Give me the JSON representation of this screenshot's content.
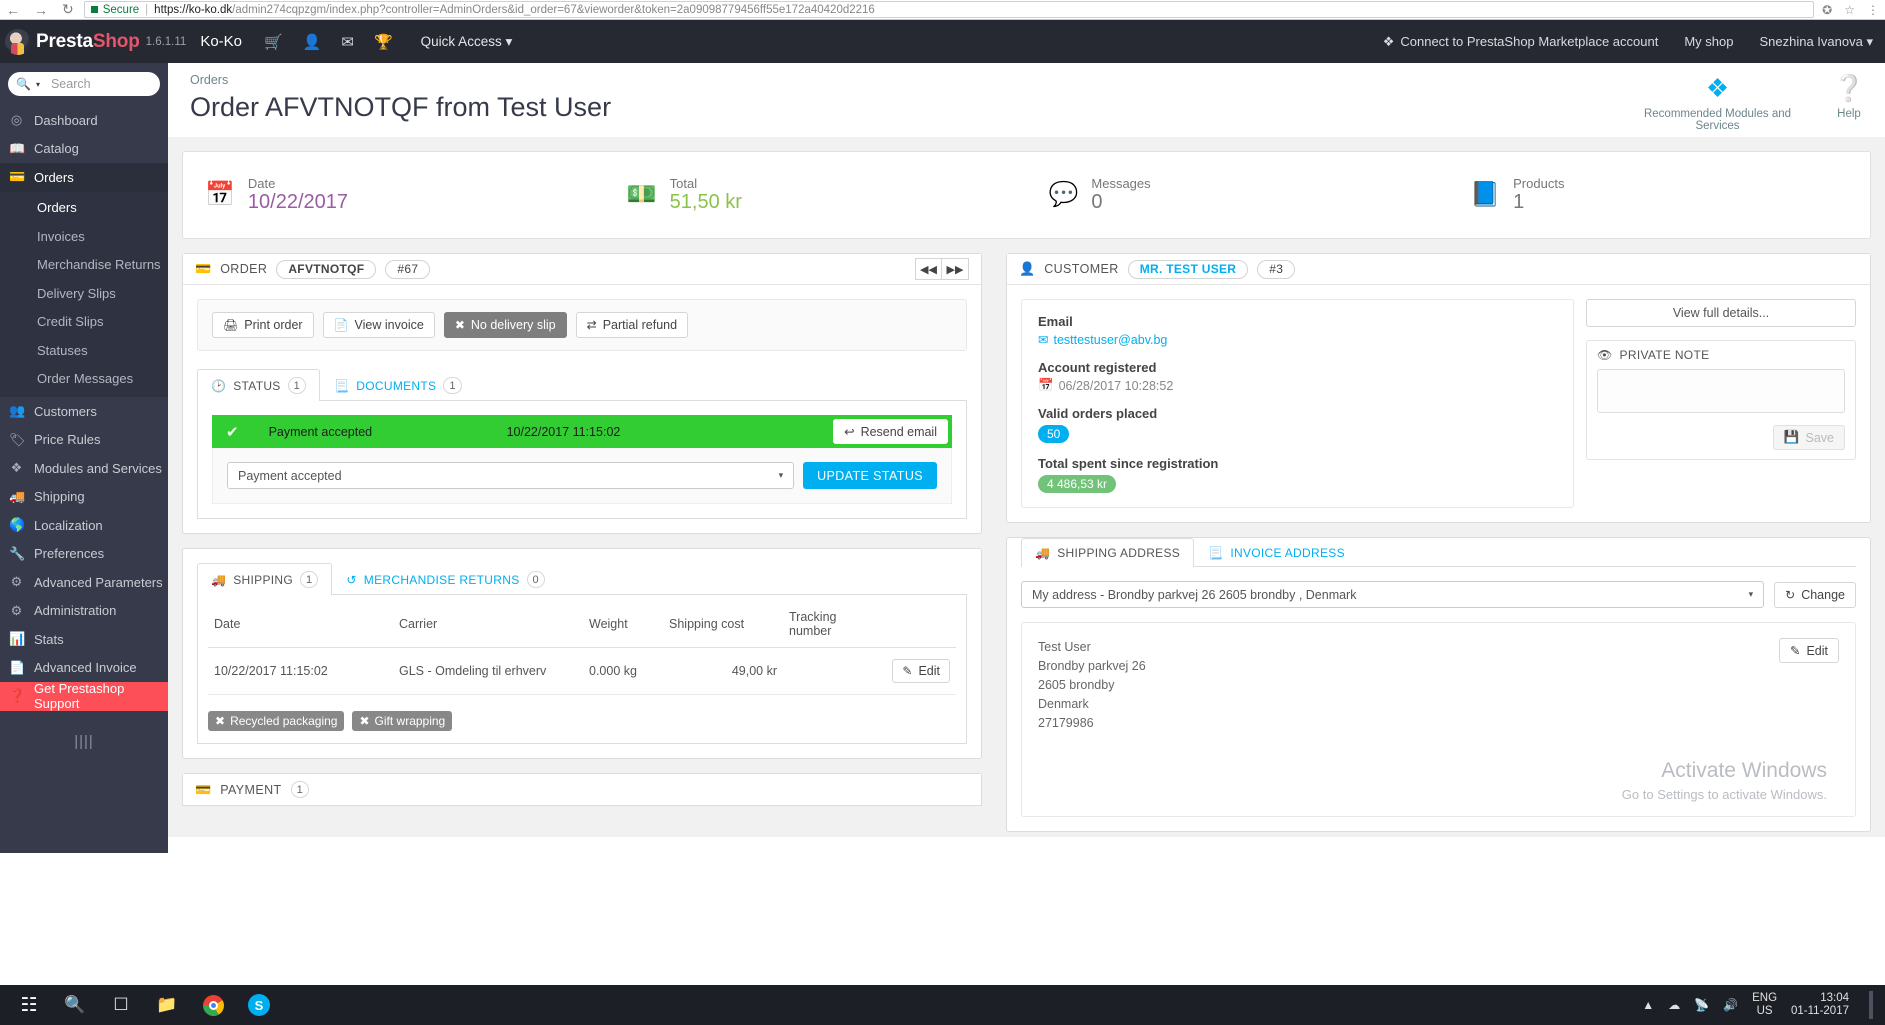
{
  "browser": {
    "secure_label": "Secure",
    "url_host": "https://ko-ko.dk",
    "url_rest": "/admin274cqpzgm/index.php?controller=AdminOrders&id_order=67&vieworder&token=2a09098779456ff55e172a40420d2216",
    "back_icon": "back-arrow-icon",
    "forward_icon": "forward-arrow-icon",
    "reload_icon": "reload-icon"
  },
  "header": {
    "brand_first": "Presta",
    "brand_second": "Shop",
    "version": "1.6.1.11",
    "shop_name": "Ko-Ko",
    "quick_access": "Quick Access",
    "marketplace": "Connect to PrestaShop Marketplace account",
    "my_shop": "My shop",
    "user": "Snezhina Ivanova",
    "icons": [
      "cart-icon",
      "user-icon",
      "envelope-icon",
      "trophy-icon"
    ]
  },
  "sidebar": {
    "search_placeholder": "Search",
    "items": [
      {
        "label": "Dashboard",
        "icon": "dashboard-icon"
      },
      {
        "label": "Catalog",
        "icon": "catalog-icon"
      },
      {
        "label": "Orders",
        "icon": "orders-icon",
        "active": true
      },
      {
        "label": "Customers",
        "icon": "customers-icon"
      },
      {
        "label": "Price Rules",
        "icon": "price-rules-icon"
      },
      {
        "label": "Modules and Services",
        "icon": "modules-icon"
      },
      {
        "label": "Shipping",
        "icon": "shipping-icon"
      },
      {
        "label": "Localization",
        "icon": "globe-icon"
      },
      {
        "label": "Preferences",
        "icon": "wrench-icon"
      },
      {
        "label": "Advanced Parameters",
        "icon": "cogs-icon"
      },
      {
        "label": "Administration",
        "icon": "gear-icon"
      },
      {
        "label": "Stats",
        "icon": "stats-icon"
      },
      {
        "label": "Advanced Invoice",
        "icon": "invoice-icon"
      },
      {
        "label": "Get Prestashop Support",
        "icon": "help-circle-icon"
      }
    ],
    "submenu": [
      {
        "label": "Orders",
        "active": true
      },
      {
        "label": "Invoices"
      },
      {
        "label": "Merchandise Returns"
      },
      {
        "label": "Delivery Slips"
      },
      {
        "label": "Credit Slips"
      },
      {
        "label": "Statuses"
      },
      {
        "label": "Order Messages"
      }
    ]
  },
  "page": {
    "breadcrumb": "Orders",
    "title": "Order AFVTNOTQF from Test User",
    "recommended_modules": "Recommended Modules and Services",
    "help": "Help"
  },
  "kpis": [
    {
      "label": "Date",
      "value": "10/22/2017",
      "icon": "calendar-icon",
      "color": "#9b5ba5"
    },
    {
      "label": "Total",
      "value": "51,50 kr",
      "icon": "money-icon",
      "color": "#8bc34a"
    },
    {
      "label": "Messages",
      "value": "0",
      "icon": "comment-icon",
      "color": "#ef5350"
    },
    {
      "label": "Products",
      "value": "1",
      "icon": "book-icon",
      "color": "#29b6f6"
    }
  ],
  "order_panel": {
    "header_icon": "credit-card-icon",
    "header_title": "ORDER",
    "reference": "AFVTNOTQF",
    "order_number": "#67",
    "prev_icon": "double-left-icon",
    "next_icon": "double-right-icon",
    "buttons": [
      {
        "label": "Print order",
        "icon": "printer-icon",
        "style": "default"
      },
      {
        "label": "View invoice",
        "icon": "file-icon",
        "style": "default"
      },
      {
        "label": "No delivery slip",
        "icon": "times-icon",
        "style": "gray"
      },
      {
        "label": "Partial refund",
        "icon": "exchange-icon",
        "style": "default"
      }
    ],
    "tabs": [
      {
        "label": "STATUS",
        "count": "1",
        "icon": "clock-icon",
        "active": true
      },
      {
        "label": "DOCUMENTS",
        "count": "1",
        "icon": "document-icon",
        "active": false
      }
    ],
    "status_row": {
      "name": "Payment accepted",
      "date": "10/22/2017 11:15:02",
      "resend_label": "Resend email",
      "resend_icon": "reply-icon",
      "check_icon": "check-icon",
      "color": "#32cd32"
    },
    "status_select_value": "Payment accepted",
    "update_status_label": "UPDATE STATUS"
  },
  "shipping_panel": {
    "tabs": [
      {
        "label": "SHIPPING",
        "count": "1",
        "icon": "truck-icon",
        "active": true
      },
      {
        "label": "MERCHANDISE RETURNS",
        "count": "0",
        "icon": "undo-icon",
        "active": false
      }
    ],
    "columns": [
      "Date",
      "Carrier",
      "Weight",
      "Shipping cost",
      "Tracking number",
      ""
    ],
    "rows": [
      {
        "date": "10/22/2017 11:15:02",
        "carrier": "GLS - Omdeling til erhverv",
        "weight": "0.000 kg",
        "shipping_cost": "49,00 kr",
        "tracking": "",
        "edit_label": "Edit",
        "edit_icon": "pencil-icon"
      }
    ],
    "options": [
      {
        "label": "Recycled packaging",
        "icon": "times-icon"
      },
      {
        "label": "Gift wrapping",
        "icon": "times-icon"
      }
    ]
  },
  "payment_panel": {
    "icon": "payment-icon",
    "title": "PAYMENT",
    "count": "1"
  },
  "customer_panel": {
    "header_icon": "user-icon",
    "header_title": "CUSTOMER",
    "customer_name": "MR. TEST USER",
    "customer_id": "#3",
    "email_label": "Email",
    "email_value": "testtestuser@abv.bg",
    "email_icon": "envelope-icon",
    "registered_label": "Account registered",
    "registered_value": "06/28/2017 10:28:52",
    "registered_icon": "calendar-icon",
    "valid_orders_label": "Valid orders placed",
    "valid_orders_value": "50",
    "total_spent_label": "Total spent since registration",
    "total_spent_value": "4 486,53 kr",
    "view_full_details": "View full details...",
    "private_note_title": "PRIVATE NOTE",
    "private_note_icon": "eye-slash-icon",
    "private_note_value": "",
    "save_label": "Save",
    "save_icon": "save-icon"
  },
  "address_panel": {
    "tabs": [
      {
        "label": "SHIPPING ADDRESS",
        "icon": "truck-icon",
        "active": true
      },
      {
        "label": "INVOICE ADDRESS",
        "icon": "document-icon",
        "active": false
      }
    ],
    "selected_address": "My address - Brondby parkvej 26 2605 brondby , Denmark",
    "change_label": "Change",
    "change_icon": "refresh-icon",
    "edit_label": "Edit",
    "edit_icon": "pencil-icon",
    "address_lines": [
      "Test User",
      "Brondby parkvej 26",
      "2605 brondby",
      "Denmark",
      "27179986"
    ]
  },
  "watermark": {
    "line1": "Activate Windows",
    "line2": "Go to Settings to activate Windows."
  },
  "taskbar": {
    "start_icon": "windows-icon",
    "search_icon": "search-icon",
    "taskview_icon": "task-view-icon",
    "explorer_icon": "file-explorer-icon",
    "chrome_icon": "chrome-icon",
    "skype_icon": "skype-icon",
    "lang_line1": "ENG",
    "lang_line2": "US",
    "time": "13:04",
    "date": "01-11-2017",
    "tray_icons": [
      "chevron-up-icon",
      "onedrive-icon",
      "network-icon",
      "volume-icon"
    ]
  }
}
